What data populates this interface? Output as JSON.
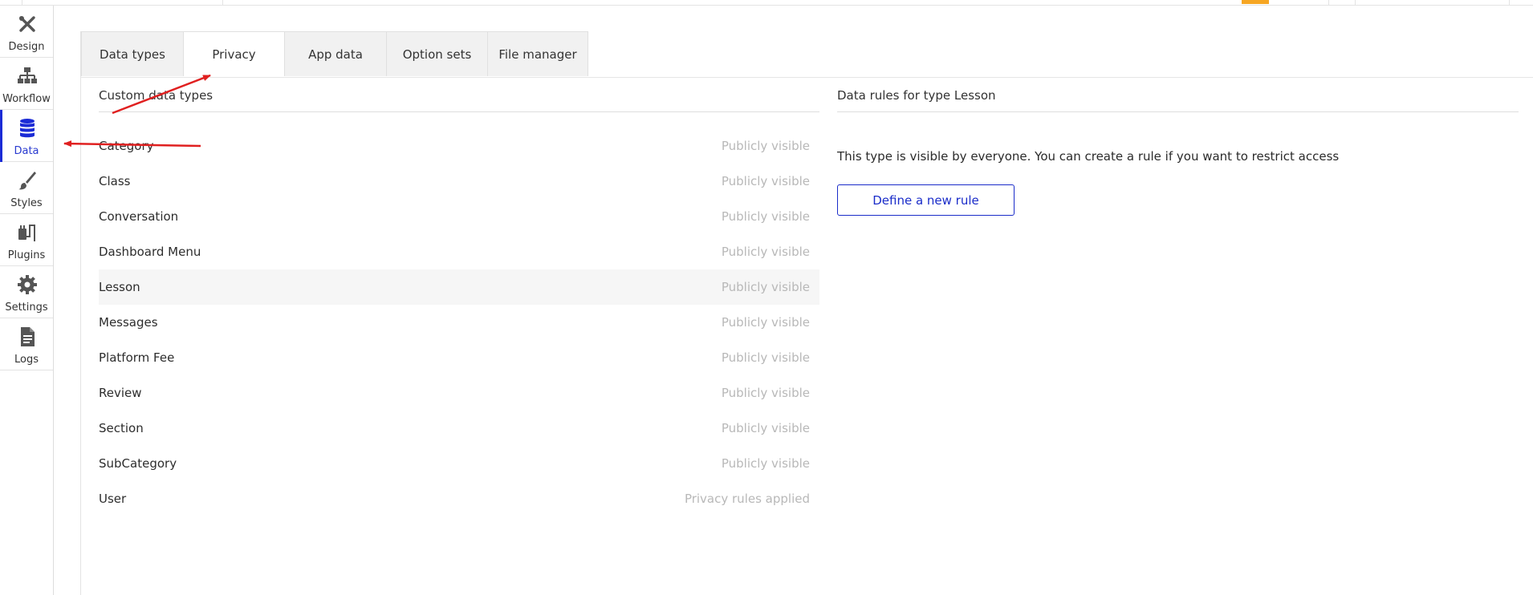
{
  "sidebar": {
    "items": [
      {
        "label": "Design",
        "icon": "design-icon"
      },
      {
        "label": "Workflow",
        "icon": "workflow-icon"
      },
      {
        "label": "Data",
        "icon": "database-icon"
      },
      {
        "label": "Styles",
        "icon": "brush-icon"
      },
      {
        "label": "Plugins",
        "icon": "plug-icon"
      },
      {
        "label": "Settings",
        "icon": "gear-icon"
      },
      {
        "label": "Logs",
        "icon": "document-icon"
      }
    ],
    "active": "Data"
  },
  "tabs": [
    {
      "label": "Data types"
    },
    {
      "label": "Privacy"
    },
    {
      "label": "App data"
    },
    {
      "label": "Option sets"
    },
    {
      "label": "File manager"
    }
  ],
  "active_tab": "Privacy",
  "left_panel": {
    "title": "Custom data types",
    "types": [
      {
        "name": "Category",
        "status": "Publicly visible"
      },
      {
        "name": "Class",
        "status": "Publicly visible"
      },
      {
        "name": "Conversation",
        "status": "Publicly visible"
      },
      {
        "name": "Dashboard Menu",
        "status": "Publicly visible"
      },
      {
        "name": "Lesson",
        "status": "Publicly visible"
      },
      {
        "name": "Messages",
        "status": "Publicly visible"
      },
      {
        "name": "Platform Fee",
        "status": "Publicly visible"
      },
      {
        "name": "Review",
        "status": "Publicly visible"
      },
      {
        "name": "Section",
        "status": "Publicly visible"
      },
      {
        "name": "SubCategory",
        "status": "Publicly visible"
      },
      {
        "name": "User",
        "status": "Privacy rules applied"
      }
    ],
    "selected": "Lesson"
  },
  "right_panel": {
    "title": "Data rules for type Lesson",
    "info": "This type is visible by everyone. You can create a rule if you want to restrict access",
    "button_label": "Define a new rule"
  },
  "colors": {
    "accent_blue": "#1a2cc9",
    "annotation_red": "#e02020",
    "top_accent": "#f6a623",
    "muted_text": "#b8b8b8"
  }
}
